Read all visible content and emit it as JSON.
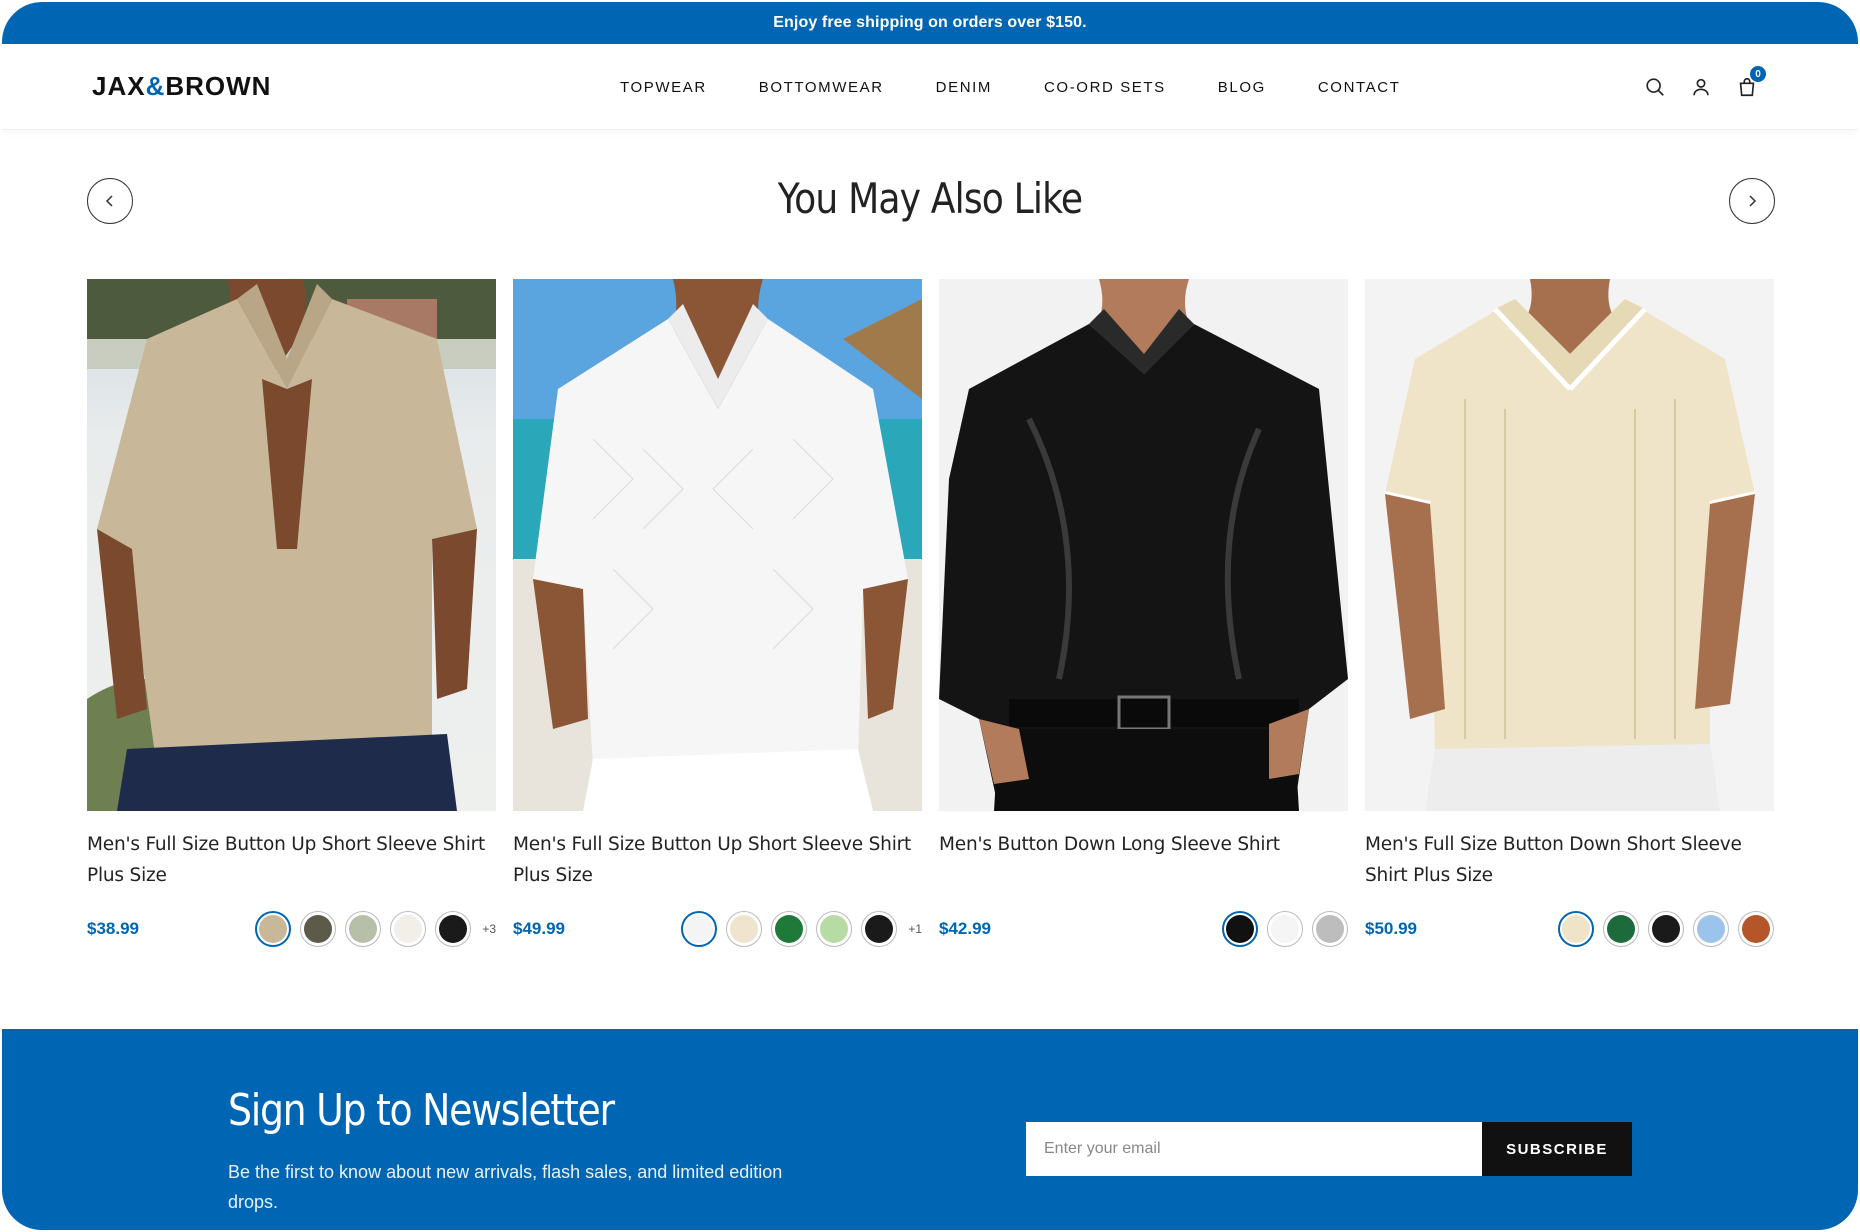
{
  "announcement": "Enjoy free shipping on orders over $150.",
  "brand": {
    "part1": "JAX",
    "amp": "&",
    "part2": "BROWN"
  },
  "nav": [
    "TOPWEAR",
    "BOTTOMWEAR",
    "DENIM",
    "CO-ORD SETS",
    "BLOG",
    "CONTACT"
  ],
  "header_icons": [
    "search-icon",
    "account-icon",
    "cart-icon"
  ],
  "cart_count": "0",
  "related": {
    "title": "You May Also Like",
    "products": [
      {
        "name": "Men's Full Size Button Up Short Sleeve Shirt Plus Size",
        "price": "$38.99",
        "swatches": [
          "#c9b79a",
          "#5c5a48",
          "#b7bfa8",
          "#f2efe9",
          "#1a1a1a"
        ],
        "more": "+3"
      },
      {
        "name": "Men's Full Size Button Up Short Sleeve Shirt Plus Size",
        "price": "$49.99",
        "swatches": [
          "#f4f4f4",
          "#efe5cf",
          "#1f7a3a",
          "#b7dca3",
          "#1a1a1a"
        ],
        "more": "+1"
      },
      {
        "name": "Men's Button Down Long Sleeve Shirt",
        "price": "$42.99",
        "swatches": [
          "#111111",
          "#f5f5f5",
          "#bdbdbd"
        ],
        "more": ""
      },
      {
        "name": "Men's Full Size Button Down Short Sleeve Shirt Plus Size",
        "price": "$50.99",
        "swatches": [
          "#efe4c8",
          "#1d6a3a",
          "#1a1a1a",
          "#9cc3ec",
          "#b5552a"
        ],
        "more": ""
      }
    ]
  },
  "newsletter": {
    "title": "Sign Up to Newsletter",
    "text": "Be the first to know about new arrivals, flash sales, and limited edition drops.",
    "placeholder": "Enter your email",
    "button": "SUBSCRIBE"
  },
  "colors": {
    "brand_blue": "#0066b3",
    "dark": "#111111"
  }
}
